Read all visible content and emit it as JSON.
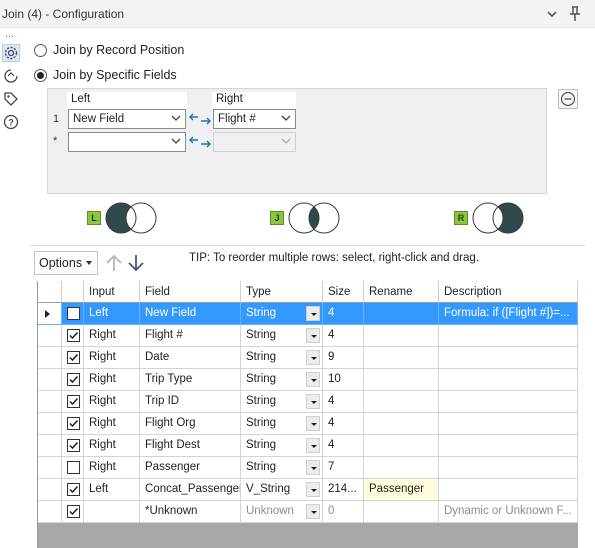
{
  "window": {
    "title": "Join (4) - Configuration"
  },
  "sidebar": {
    "dots": "...",
    "icons": [
      "gear-icon",
      "refresh-icon",
      "tag-icon",
      "help-icon"
    ]
  },
  "join_mode": {
    "options": [
      {
        "label": "Join by Record Position",
        "checked": false
      },
      {
        "label": "Join by Specific Fields",
        "checked": true
      }
    ]
  },
  "join_fields": {
    "left_header": "Left",
    "right_header": "Right",
    "rows": [
      {
        "num": "1",
        "left": "New Field",
        "right": "Flight #"
      },
      {
        "num": "*",
        "left": "",
        "right": ""
      }
    ]
  },
  "venn_tags": [
    "L",
    "J",
    "R"
  ],
  "toolbar": {
    "options_label": "Options",
    "tip": "TIP: To reorder multiple rows: select, right-click and drag."
  },
  "grid": {
    "headers": [
      "Input",
      "Field",
      "Type",
      "Size",
      "Rename",
      "Description"
    ],
    "rows": [
      {
        "checked": false,
        "input": "Left",
        "field": "New Field",
        "type": "String",
        "size": "4",
        "rename": "",
        "description": "Formula: if ([Flight #])=...",
        "selected": true
      },
      {
        "checked": true,
        "input": "Right",
        "field": "Flight #",
        "type": "String",
        "size": "4",
        "rename": "",
        "description": ""
      },
      {
        "checked": true,
        "input": "Right",
        "field": "Date",
        "type": "String",
        "size": "9",
        "rename": "",
        "description": ""
      },
      {
        "checked": true,
        "input": "Right",
        "field": "Trip Type",
        "type": "String",
        "size": "10",
        "rename": "",
        "description": ""
      },
      {
        "checked": true,
        "input": "Right",
        "field": "Trip ID",
        "type": "String",
        "size": "4",
        "rename": "",
        "description": ""
      },
      {
        "checked": true,
        "input": "Right",
        "field": "Flight Org",
        "type": "String",
        "size": "4",
        "rename": "",
        "description": ""
      },
      {
        "checked": true,
        "input": "Right",
        "field": "Flight Dest",
        "type": "String",
        "size": "4",
        "rename": "",
        "description": ""
      },
      {
        "checked": false,
        "input": "Right",
        "field": "Passenger",
        "type": "String",
        "size": "7",
        "rename": "",
        "description": ""
      },
      {
        "checked": true,
        "input": "Left",
        "field": "Concat_Passenger",
        "type": "V_String",
        "size": "214...",
        "rename": "Passenger",
        "description": ""
      },
      {
        "checked": true,
        "input": "",
        "field": "*Unknown",
        "type": "Unknown",
        "size": "0",
        "rename": "",
        "description": "Dynamic or Unknown F...",
        "muted": true
      }
    ]
  }
}
